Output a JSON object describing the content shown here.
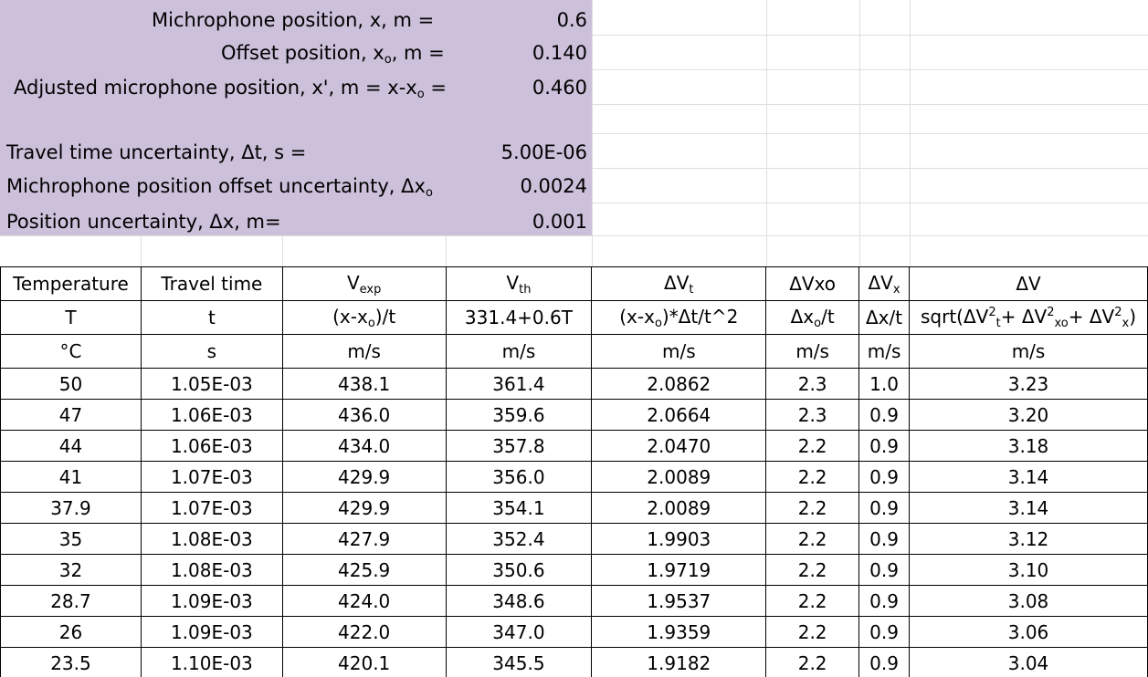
{
  "params": [
    {
      "label": "Michrophone position, x, m =",
      "value": "0.6"
    },
    {
      "label_pre": "Offset position, x",
      "label_sub": "o",
      "label_post": ", m =",
      "value": "0.140"
    },
    {
      "label_pre": "Adjusted microphone position, x', m = x-x",
      "label_sub": "o",
      "label_post": " =",
      "value": "0.460"
    },
    {
      "label": "Travel time uncertainty, Δt, s =",
      "value": "5.00E-06"
    },
    {
      "label_pre": "Michrophone position offset uncertainty, Δx",
      "label_sub": "o",
      "value": "0.0024"
    },
    {
      "label": "Position uncertainty, Δx, m=",
      "value": "0.001"
    }
  ],
  "table": {
    "header1": {
      "temp": "Temperature",
      "time": "Travel time",
      "vexp_main": "V",
      "vexp_sub": "exp",
      "vth_main": "V",
      "vth_sub": "th",
      "dvt_main": "ΔV",
      "dvt_sub": "t",
      "dvxo": "ΔVxo",
      "dvx_main": "ΔV",
      "dvx_sub": "x",
      "dv": "ΔV"
    },
    "header2": {
      "temp": "T",
      "time": "t",
      "vexp_pre": "(x-x",
      "vexp_sub": "o",
      "vexp_post": ")/t",
      "vth": "331.4+0.6T",
      "dvt_pre": "(x-x",
      "dvt_sub": "o",
      "dvt_post": ")*Δt/t^2",
      "dvxo_pre": "Δx",
      "dvxo_sub": "o",
      "dvxo_post": "/t",
      "dvx": "Δx/t",
      "dv_a": "sqrt(ΔV",
      "dv_sup1": "2",
      "dv_sub1": "t",
      "dv_b": "+ ΔV",
      "dv_sup2": "2",
      "dv_sub2": "xo",
      "dv_c": "+ ΔV",
      "dv_sup3": "2",
      "dv_sub3": "x",
      "dv_d": ")"
    },
    "units": [
      "°C",
      "s",
      "m/s",
      "m/s",
      "m/s",
      "m/s",
      "m/s",
      "m/s"
    ],
    "rows": [
      [
        "50",
        "1.05E-03",
        "438.1",
        "361.4",
        "2.0862",
        "2.3",
        "1.0",
        "3.23"
      ],
      [
        "47",
        "1.06E-03",
        "436.0",
        "359.6",
        "2.0664",
        "2.3",
        "0.9",
        "3.20"
      ],
      [
        "44",
        "1.06E-03",
        "434.0",
        "357.8",
        "2.0470",
        "2.2",
        "0.9",
        "3.18"
      ],
      [
        "41",
        "1.07E-03",
        "429.9",
        "356.0",
        "2.0089",
        "2.2",
        "0.9",
        "3.14"
      ],
      [
        "37.9",
        "1.07E-03",
        "429.9",
        "354.1",
        "2.0089",
        "2.2",
        "0.9",
        "3.14"
      ],
      [
        "35",
        "1.08E-03",
        "427.9",
        "352.4",
        "1.9903",
        "2.2",
        "0.9",
        "3.12"
      ],
      [
        "32",
        "1.08E-03",
        "425.9",
        "350.6",
        "1.9719",
        "2.2",
        "0.9",
        "3.10"
      ],
      [
        "28.7",
        "1.09E-03",
        "424.0",
        "348.6",
        "1.9537",
        "2.2",
        "0.9",
        "3.08"
      ],
      [
        "26",
        "1.09E-03",
        "422.0",
        "347.0",
        "1.9359",
        "2.2",
        "0.9",
        "3.06"
      ],
      [
        "23.5",
        "1.10E-03",
        "420.1",
        "345.5",
        "1.9182",
        "2.2",
        "0.9",
        "3.04"
      ]
    ]
  }
}
